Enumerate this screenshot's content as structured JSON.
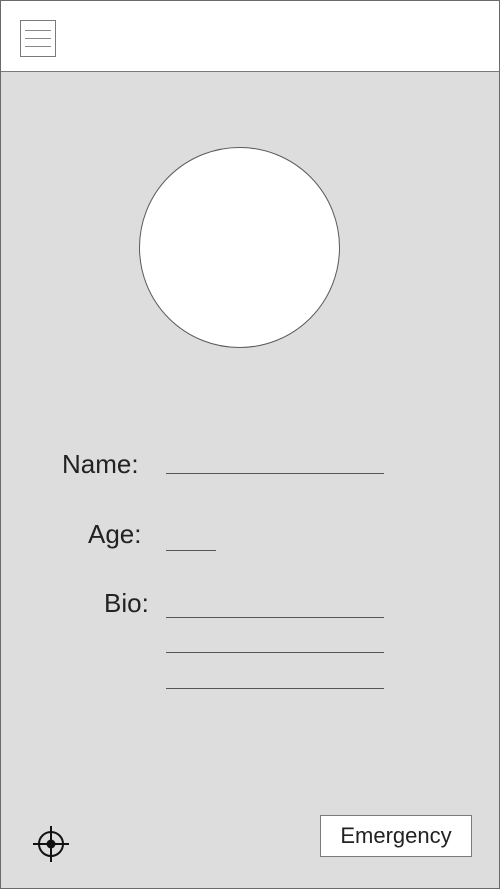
{
  "toolbar": {
    "menu_icon": "hamburger-menu-icon"
  },
  "profile": {
    "name_label": "Name:",
    "name_value": "",
    "age_label": "Age:",
    "age_value": "",
    "bio_label": "Bio:",
    "bio_lines": [
      "",
      "",
      ""
    ]
  },
  "footer": {
    "location_icon": "crosshair-icon",
    "emergency_label": "Emergency"
  },
  "colors": {
    "content_background": "#dddddd",
    "header_background": "#ffffff",
    "avatar_fill": "#ffffff"
  }
}
